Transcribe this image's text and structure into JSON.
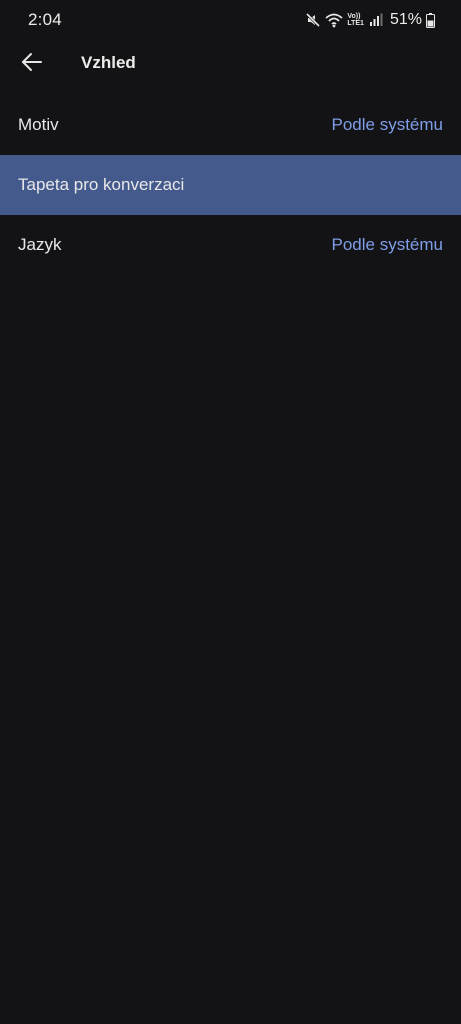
{
  "status_bar": {
    "time": "2:04",
    "network_top": "Vo))",
    "network_bottom": "LTE1",
    "battery_percent": "51%",
    "icons": [
      "mute-icon",
      "wifi-icon",
      "signal-icon",
      "battery-icon"
    ]
  },
  "header": {
    "back_icon": "arrow-left-icon",
    "title": "Vzhled"
  },
  "settings": {
    "items": [
      {
        "label": "Motiv",
        "value": "Podle systému",
        "selected": false
      },
      {
        "label": "Tapeta pro konverzaci",
        "value": "",
        "selected": true
      },
      {
        "label": "Jazyk",
        "value": "Podle systému",
        "selected": false
      }
    ]
  },
  "colors": {
    "background": "#131315",
    "accent": "#7f9ee8",
    "selected_row": "#445a8c",
    "text": "#e8e8ea"
  }
}
